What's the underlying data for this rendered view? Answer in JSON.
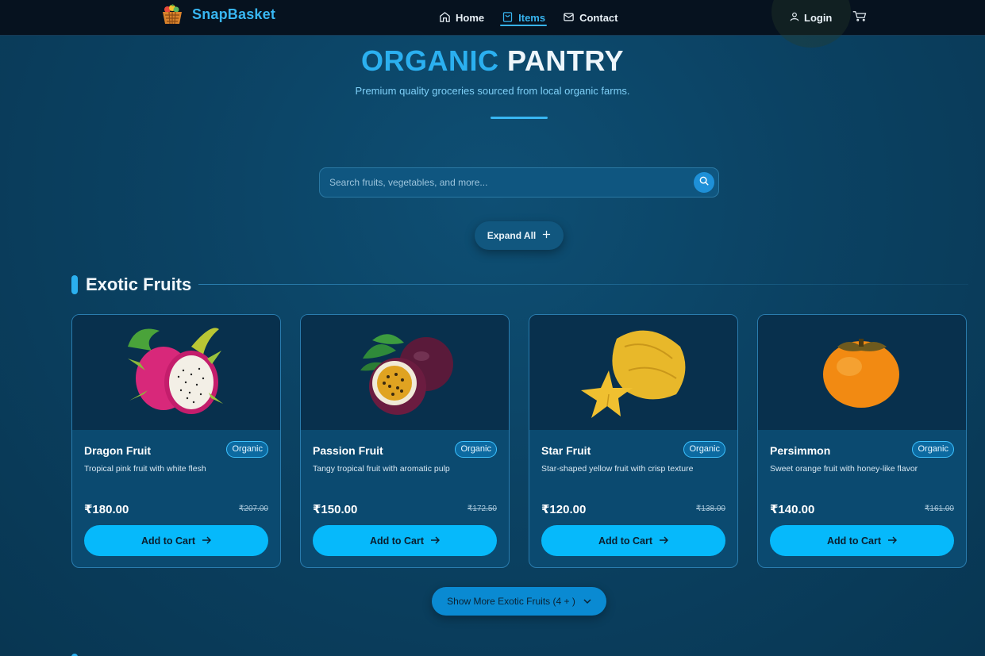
{
  "brand": {
    "name": "SnapBasket",
    "logo_icon": "basket-logo-icon"
  },
  "nav": {
    "items": [
      {
        "label": "Home",
        "icon": "home-icon"
      },
      {
        "label": "Items",
        "icon": "bag-icon",
        "active": true
      },
      {
        "label": "Contact",
        "icon": "mail-icon"
      }
    ],
    "login_label": "Login",
    "cart_icon": "cart-icon"
  },
  "hero": {
    "title_part1": "ORGANIC",
    "title_part2": "PANTRY",
    "subtitle": "Premium quality groceries sourced from local organic farms."
  },
  "search": {
    "placeholder": "Search fruits, vegetables, and more...",
    "value": ""
  },
  "expand_label": "Expand All",
  "section": {
    "title": "Exotic Fruits",
    "more_label": "Show More Exotic Fruits (4 + )"
  },
  "products": [
    {
      "name": "Dragon Fruit",
      "badge": "Organic",
      "description": "Tropical pink fruit with white flesh",
      "price": "₹180.00",
      "old_price": "₹207.00",
      "cart_label": "Add to Cart",
      "image": "dragon-fruit"
    },
    {
      "name": "Passion Fruit",
      "badge": "Organic",
      "description": "Tangy tropical fruit with aromatic pulp",
      "price": "₹150.00",
      "old_price": "₹172.50",
      "cart_label": "Add to Cart",
      "image": "passion-fruit"
    },
    {
      "name": "Star Fruit",
      "badge": "Organic",
      "description": "Star-shaped yellow fruit with crisp texture",
      "price": "₹120.00",
      "old_price": "₹138.00",
      "cart_label": "Add to Cart",
      "image": "star-fruit"
    },
    {
      "name": "Persimmon",
      "badge": "Organic",
      "description": "Sweet orange fruit with honey-like flavor",
      "price": "₹140.00",
      "old_price": "₹161.00",
      "cart_label": "Add to Cart",
      "image": "persimmon"
    }
  ],
  "colors": {
    "accent": "#2bb0f0",
    "button": "#06b9fb",
    "background": "#0b4263",
    "navbar": "#06121f"
  }
}
